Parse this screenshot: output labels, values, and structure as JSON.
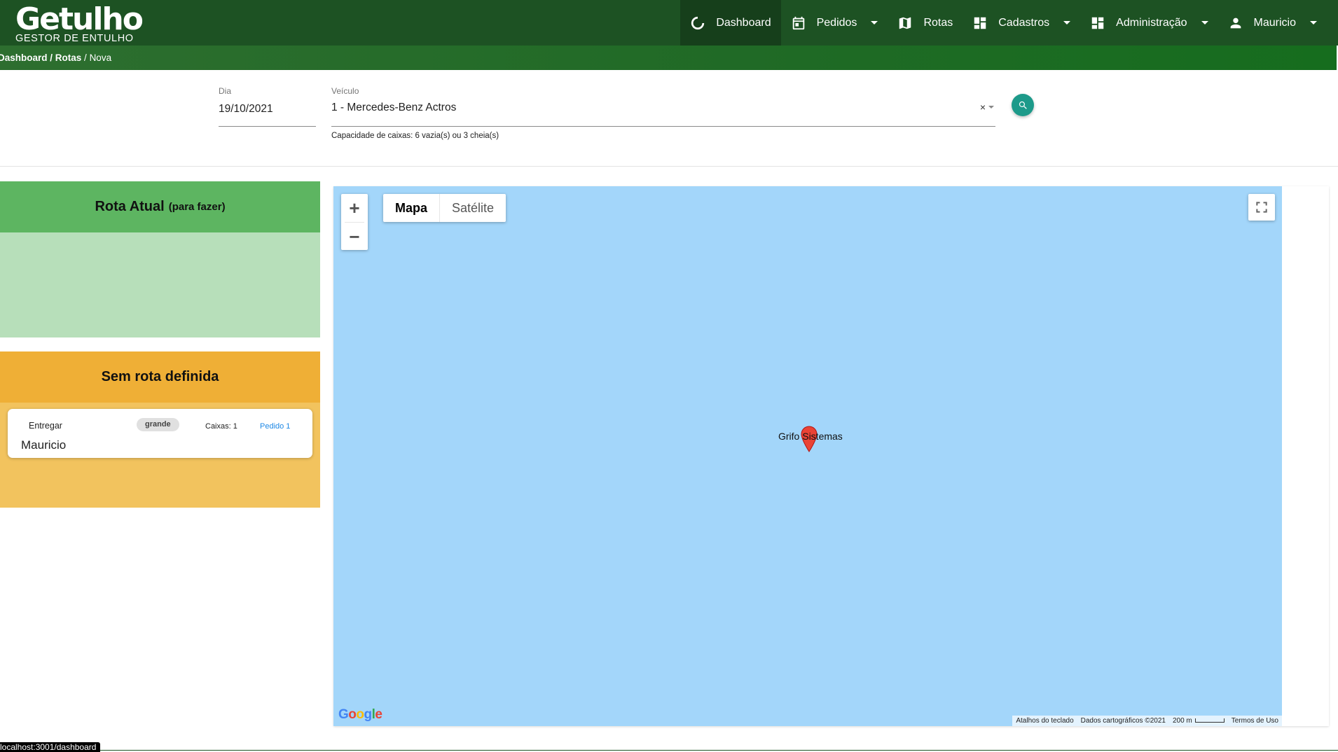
{
  "app": {
    "brand_name": "Getulho",
    "brand_sub": "GESTOR DE ENTULHO"
  },
  "nav": {
    "items": [
      {
        "label": "Dashboard",
        "icon": "dashboard-spinner-icon",
        "active": true
      },
      {
        "label": "Pedidos",
        "icon": "calendar-icon",
        "dropdown": true
      },
      {
        "label": "Rotas",
        "icon": "map-icon"
      },
      {
        "label": "Cadastros",
        "icon": "grid-icon",
        "dropdown": true
      },
      {
        "label": "Administração",
        "icon": "grid-icon",
        "dropdown": true
      },
      {
        "label": "Mauricio",
        "icon": "user-icon",
        "dropdown": true
      }
    ]
  },
  "breadcrumb": {
    "dashboard": "Dashboard",
    "sep1": " / ",
    "rotas": "Rotas",
    "sep2": " / ",
    "current": "Nova"
  },
  "filters": {
    "dia_label": "Dia",
    "dia_value": "19/10/2021",
    "veiculo_label": "Veículo",
    "veiculo_value": "1 - Mercedes-Benz Actros",
    "clear_symbol": "×",
    "capacidade": "Capacidade de caixas: 6 vazia(s) ou 3 cheia(s)"
  },
  "rota_atual": {
    "title": "Rota Atual",
    "subtitle": "(para fazer)"
  },
  "sem_rota": {
    "title": "Sem rota definida",
    "cards": [
      {
        "action": "Entregar",
        "size": "grande",
        "caixas": "Caixas: 1",
        "pedido": "Pedido 1",
        "cliente": "Mauricio"
      }
    ]
  },
  "map": {
    "type_map": "Mapa",
    "type_satellite": "Satélite",
    "zoom_in": "+",
    "zoom_out": "−",
    "marker_label": "Grifo Sistemas",
    "google": "Google",
    "footer_shortcuts": "Atalhos do teclado",
    "footer_data": "Dados cartográficos ©2021",
    "footer_scale": "200 m",
    "footer_terms": "Termos de Uso",
    "colors": {
      "water": "#a3d6fa",
      "marker": "#ea4335"
    }
  },
  "status_bar": {
    "url": "localhost:3001/dashboard"
  },
  "colors": {
    "navbar": "#1d5223",
    "rota_head": "#5db561",
    "rota_body": "#b7dfba",
    "sem_head": "#efaf36",
    "sem_body": "#f2c35e",
    "search_button": "#1d9a8a"
  }
}
